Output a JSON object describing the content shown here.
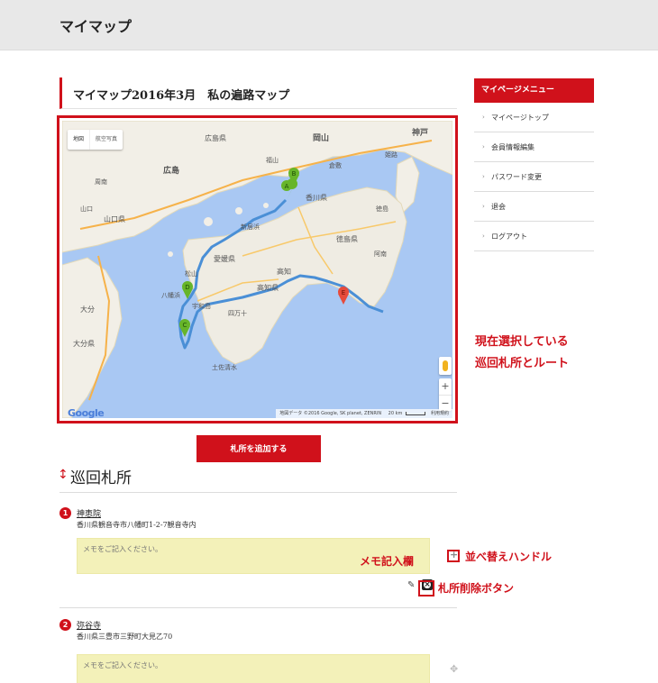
{
  "header": {
    "title": "マイマップ"
  },
  "page": {
    "heading": "マイマップ2016年3月　私の遍路マップ"
  },
  "map": {
    "type_controls": [
      "地図",
      "航空写真"
    ],
    "zoom_in": "+",
    "zoom_out": "−",
    "logo": "Google",
    "attribution": "地図データ ©2016 Google, SK planet, ZENRIN",
    "scale_label": "20 km",
    "terms": "利用規約",
    "markers": [
      "A",
      "B",
      "C",
      "D",
      "E"
    ],
    "place_labels": [
      "広島県",
      "岡山",
      "神戸",
      "広島",
      "山口",
      "山口県",
      "香川県",
      "徳島県",
      "愛媛県",
      "高知",
      "高知県",
      "大分",
      "大分県",
      "宇和島",
      "四万十",
      "八幡浜",
      "新居浜",
      "松山",
      "土佐清水",
      "周南",
      "福山",
      "姫路",
      "倉敷",
      "徳島",
      "阿南"
    ],
    "colors": {
      "sea": "#a9c8f3",
      "land": "#f2efe7",
      "route": "#4a8fd6",
      "marker_green": "#67b52a",
      "marker_red": "#e64b3c"
    }
  },
  "callouts": {
    "route_line1": "現在選択している",
    "route_line2": "巡回札所とルート",
    "memo": "メモ記入欄",
    "handle": "並べ替えハンドル",
    "delete": "札所削除ボタン"
  },
  "actions": {
    "add_label": "札所を追加する"
  },
  "section": {
    "title": "巡回札所"
  },
  "items": [
    {
      "number": "1",
      "name": "神恵院",
      "address": "香川県観音寺市八幡町1-2-7観音寺内",
      "memo_placeholder": "メモをご記入ください。"
    },
    {
      "number": "2",
      "name": "弥谷寺",
      "address": "香川県三豊市三野町大見乙70",
      "memo_placeholder": "メモをご記入ください。"
    }
  ],
  "sidebar": {
    "heading": "マイページメニュー",
    "items": [
      {
        "label": "マイページトップ"
      },
      {
        "label": "会員情報編集"
      },
      {
        "label": "パスワード変更"
      },
      {
        "label": "退会"
      },
      {
        "label": "ログアウト"
      }
    ]
  },
  "icons": {
    "section": "updown-arrow-icon",
    "edit": "pencil-icon",
    "delete": "delete-icon",
    "handle": "drag-handle-icon",
    "chevron": "chevron-right-icon"
  }
}
